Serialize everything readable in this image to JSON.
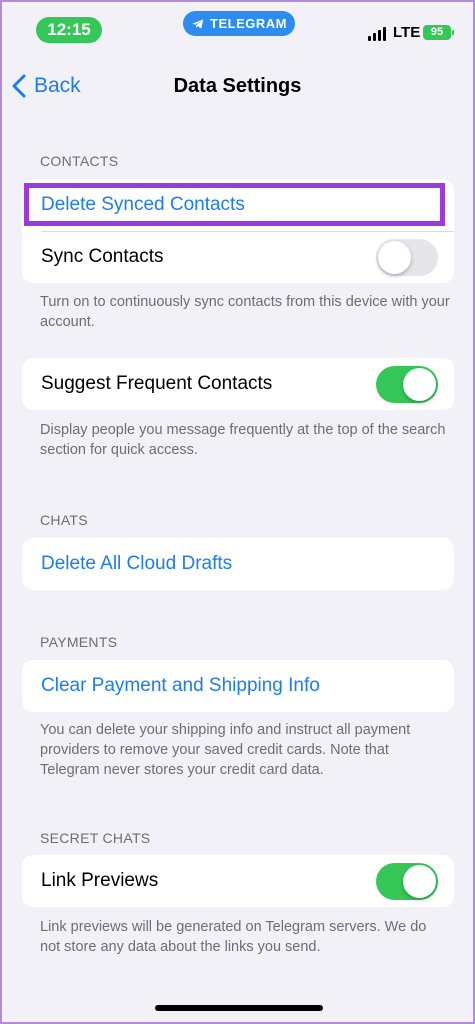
{
  "status_bar": {
    "time": "12:15",
    "app_pill": "TELEGRAM",
    "network": "LTE",
    "battery": "95"
  },
  "nav": {
    "back_label": "Back",
    "title": "Data Settings"
  },
  "sections": {
    "contacts": {
      "header": "CONTACTS",
      "delete_synced": "Delete Synced Contacts",
      "sync_contacts": "Sync Contacts",
      "sync_contacts_on": false,
      "sync_footnote": "Turn on to continuously sync contacts from this device with your account.",
      "suggest_frequent": "Suggest Frequent Contacts",
      "suggest_frequent_on": true,
      "suggest_footnote": "Display people you message frequently at the top of the search section for quick access."
    },
    "chats": {
      "header": "CHATS",
      "delete_drafts": "Delete All Cloud Drafts"
    },
    "payments": {
      "header": "PAYMENTS",
      "clear_payment": "Clear Payment and Shipping Info",
      "footnote": "You can delete your shipping info and instruct all payment providers to remove your saved credit cards. Note that Telegram never stores your credit card data."
    },
    "secret_chats": {
      "header": "SECRET CHATS",
      "link_previews": "Link Previews",
      "link_previews_on": true,
      "footnote": "Link previews will be generated on Telegram servers. We do not store any data about the links you send."
    }
  },
  "colors": {
    "accent": "#1b7cf3",
    "toggle_on": "#36c759",
    "highlight": "#9b3ae0",
    "background": "#f2f1f7"
  }
}
